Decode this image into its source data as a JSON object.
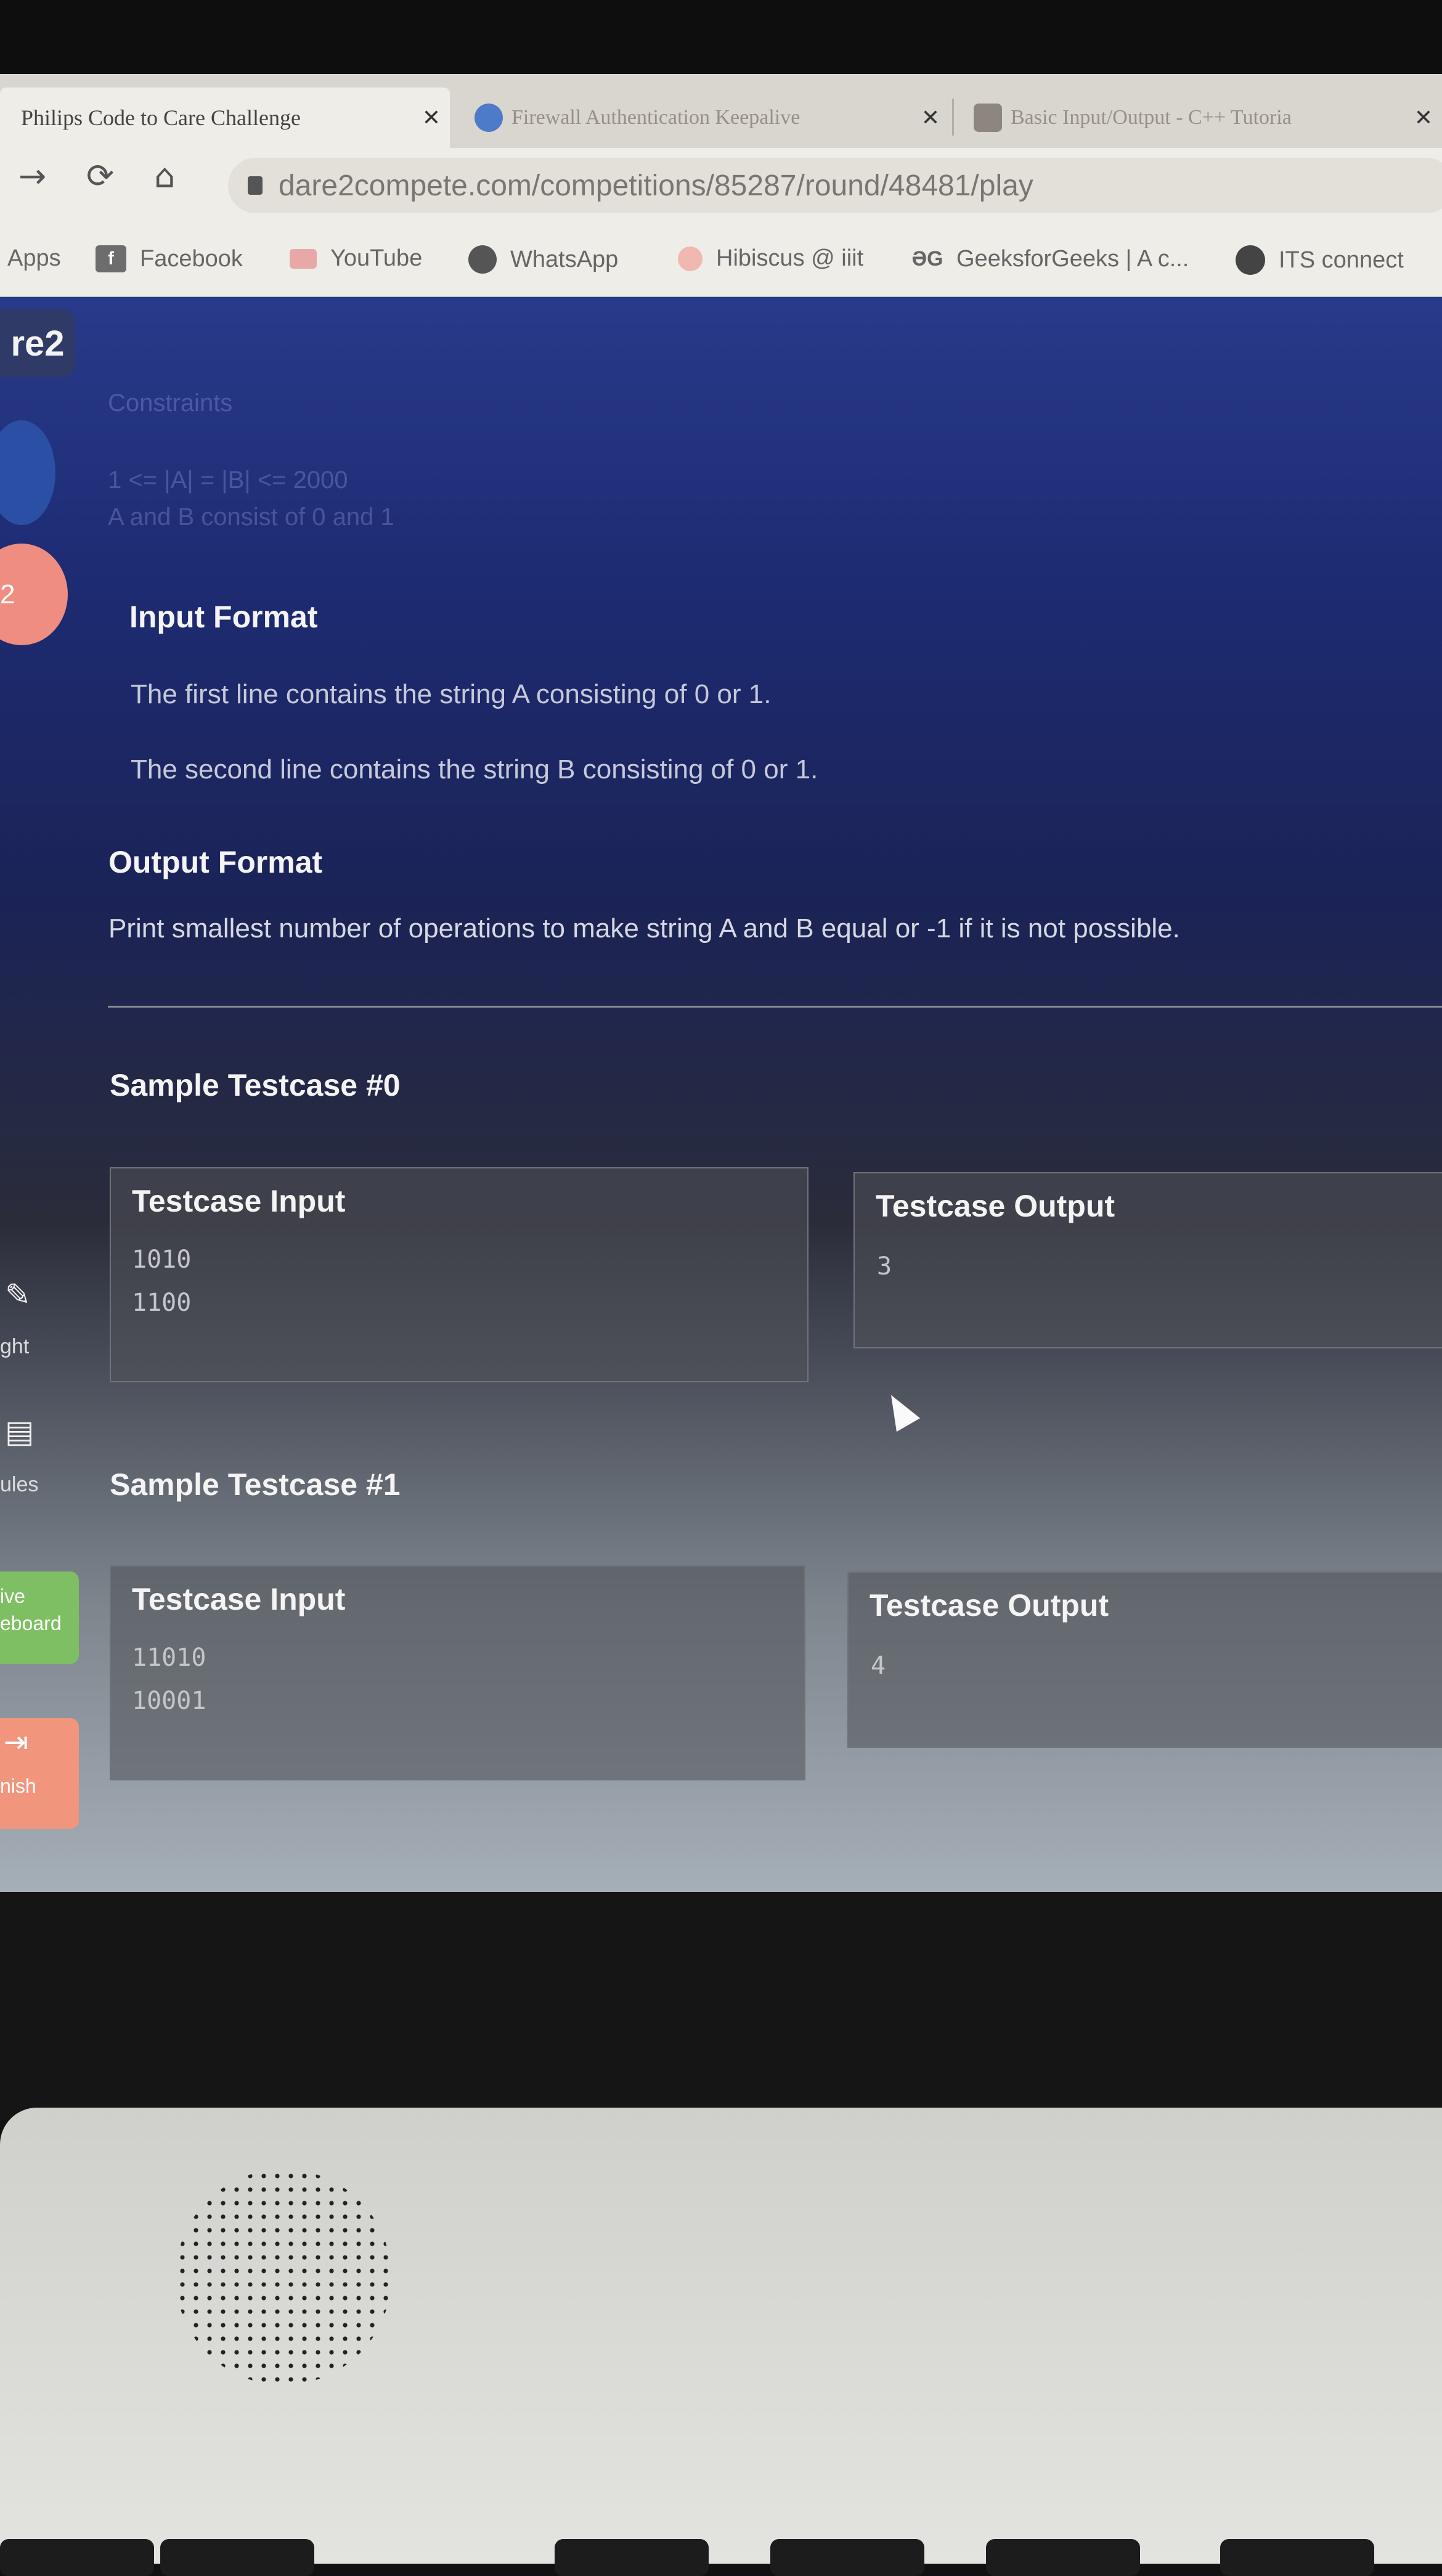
{
  "browser": {
    "active_tab": {
      "title": "Philips Code to Care Challenge",
      "close": "✕"
    },
    "tabs": [
      {
        "title": "Firewall Authentication Keepalive",
        "close": "✕"
      },
      {
        "title": "Basic Input/Output - C++ Tutoria",
        "close": "✕"
      }
    ],
    "url": "dare2compete.com/competitions/85287/round/48481/play",
    "bookmarks": [
      {
        "label": "Apps"
      },
      {
        "label": "Facebook"
      },
      {
        "label": "YouTube"
      },
      {
        "label": "WhatsApp"
      },
      {
        "label": "Hibiscus @ iiit"
      },
      {
        "label": "GeeksforGeeks | A c..."
      },
      {
        "label": "ITS connect"
      }
    ]
  },
  "sidebar": {
    "logo": "re2",
    "badge": "2",
    "items": [
      {
        "label": "ght"
      },
      {
        "label": "ules"
      }
    ],
    "leaderboard_button": {
      "line1": "ive",
      "line2": "eboard"
    },
    "finish_button": {
      "label": "nish"
    }
  },
  "problem": {
    "constraints_heading": "Constraints",
    "constraints": [
      "1 <= |A| = |B| <= 2000",
      "A and B consist of 0 and 1"
    ],
    "input_format": {
      "heading": "Input Format",
      "lines": [
        "The first line contains the string A consisting of 0 or 1.",
        "The second line contains the string B consisting of 0 or 1."
      ]
    },
    "output_format": {
      "heading": "Output Format",
      "text": "Print smallest number of operations to make string A and B equal or -1 if it is not possible."
    },
    "samples": [
      {
        "heading": "Sample Testcase #0",
        "input_label": "Testcase Input",
        "input": [
          "1010",
          "1100"
        ],
        "output_label": "Testcase Output",
        "output": "3"
      },
      {
        "heading": "Sample Testcase #1",
        "input_label": "Testcase Input",
        "input": [
          "11010",
          "10001"
        ],
        "output_label": "Testcase Output",
        "output": "4"
      }
    ]
  },
  "taskbar": {
    "icons": [
      "search-icon",
      "store-icon",
      "windows-tile-icon",
      "cube-app-icon",
      "sublime-text-icon",
      "vscode-icon",
      "edge-icon",
      "chrome-icon",
      "git-icon"
    ]
  }
}
